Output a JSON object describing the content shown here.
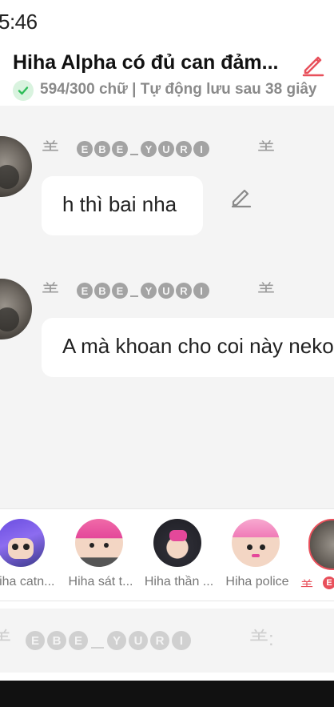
{
  "status_bar": {
    "time": "5:46"
  },
  "header": {
    "title": "Hiha Alpha có đủ can đảm...",
    "subline": "594/300 chữ | Tự động lưu sau 38 giây"
  },
  "messages": [
    {
      "name_chars": [
        "E",
        "B",
        "E",
        "_",
        "Y",
        "U",
        "R",
        "I"
      ],
      "text": "h thì bai nha"
    },
    {
      "name_chars": [
        "E",
        "B",
        "E",
        "_",
        "Y",
        "U",
        "R",
        "I"
      ],
      "text": "A mà khoan cho coi này neko"
    }
  ],
  "characters": [
    {
      "label": "Hiha catn..."
    },
    {
      "label": "Hiha sát t..."
    },
    {
      "label": "Hiha thần ..."
    },
    {
      "label": "Hiha police"
    }
  ],
  "input": {
    "name_chars": [
      "E",
      "B",
      "E",
      "_",
      "Y",
      "U",
      "R",
      "I"
    ]
  },
  "colors": {
    "accent": "#e8505b",
    "check": "#2ebd59",
    "bubble_bg": "#ffffff",
    "chat_bg": "#f4f4f4"
  }
}
